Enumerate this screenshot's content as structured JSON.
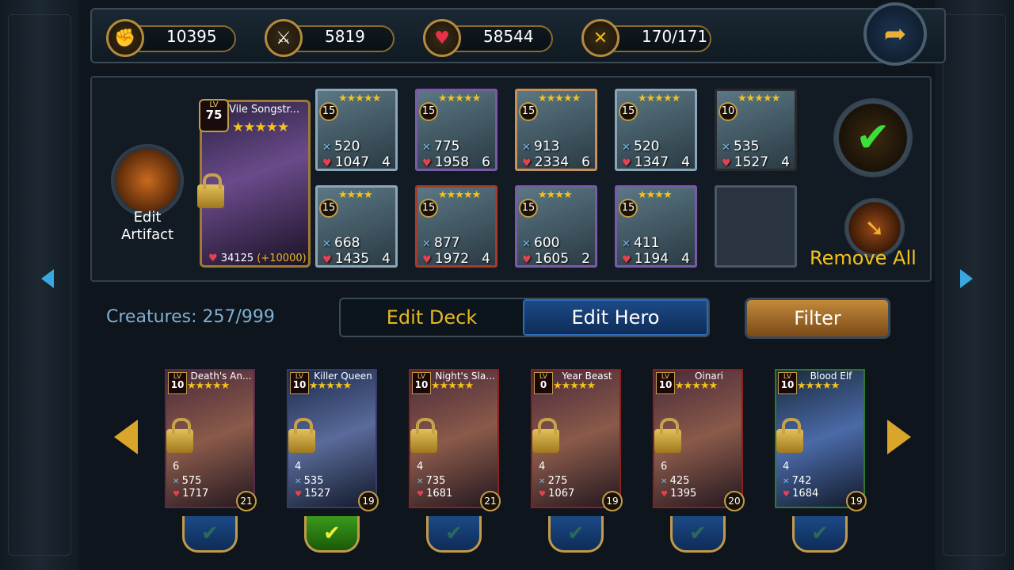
{
  "stats": [
    {
      "icon": "fist-icon",
      "value": "10395"
    },
    {
      "icon": "axe-icon",
      "value": "5819"
    },
    {
      "icon": "heart-icon",
      "value": "58544"
    },
    {
      "icon": "crossed-swords-icon",
      "value": "170/171"
    }
  ],
  "artifact": {
    "label_line1": "Edit",
    "label_line2": "Artifact"
  },
  "hero": {
    "lv_label": "LV",
    "level": "75",
    "name": "Vile Songstr...",
    "stars": "★★★★★",
    "hp": "34125",
    "bonus": "(+10000)"
  },
  "deck": [
    {
      "level": "15",
      "stars": "★★★★★",
      "atk": "520",
      "hp": "1047",
      "cost": "4"
    },
    {
      "level": "15",
      "stars": "★★★★★",
      "atk": "775",
      "hp": "1958",
      "cost": "6"
    },
    {
      "level": "15",
      "stars": "★★★★★",
      "atk": "913",
      "hp": "2334",
      "cost": "6"
    },
    {
      "level": "15",
      "stars": "★★★★★",
      "atk": "520",
      "hp": "1347",
      "cost": "4"
    },
    {
      "level": "10",
      "stars": "★★★★★",
      "atk": "535",
      "hp": "1527",
      "cost": "4"
    },
    {
      "level": "15",
      "stars": "★★★★",
      "atk": "668",
      "hp": "1435",
      "cost": "4"
    },
    {
      "level": "15",
      "stars": "★★★★★",
      "atk": "877",
      "hp": "1972",
      "cost": "4"
    },
    {
      "level": "15",
      "stars": "★★★★",
      "atk": "600",
      "hp": "1605",
      "cost": "2"
    },
    {
      "level": "15",
      "stars": "★★★★",
      "atk": "411",
      "hp": "1194",
      "cost": "4"
    }
  ],
  "remove_all": "Remove All",
  "creatures_label": "Creatures: 257/999",
  "tabs": {
    "deck": "Edit Deck",
    "hero": "Edit Hero"
  },
  "filter": "Filter",
  "cards": [
    {
      "lv_label": "LV",
      "level": "10",
      "name": "Death's An...",
      "stars": "★★★★★",
      "cost": "6",
      "atk": "575",
      "hp": "1717",
      "rank": "21"
    },
    {
      "lv_label": "LV",
      "level": "10",
      "name": "Killer Queen",
      "stars": "★★★★★",
      "cost": "4",
      "atk": "535",
      "hp": "1527",
      "rank": "19"
    },
    {
      "lv_label": "LV",
      "level": "10",
      "name": "Night's Sla...",
      "stars": "★★★★★",
      "cost": "4",
      "atk": "735",
      "hp": "1681",
      "rank": "21"
    },
    {
      "lv_label": "LV",
      "level": "0",
      "name": "Year Beast",
      "stars": "★★★★★",
      "cost": "4",
      "atk": "275",
      "hp": "1067",
      "rank": "19"
    },
    {
      "lv_label": "LV",
      "level": "10",
      "name": "Oinari",
      "stars": "★★★★★",
      "cost": "6",
      "atk": "425",
      "hp": "1395",
      "rank": "20"
    },
    {
      "lv_label": "LV",
      "level": "10",
      "name": "Blood Elf",
      "stars": "★★★★★",
      "cost": "4",
      "atk": "742",
      "hp": "1684",
      "rank": "19"
    }
  ],
  "selected_card_index": 1
}
